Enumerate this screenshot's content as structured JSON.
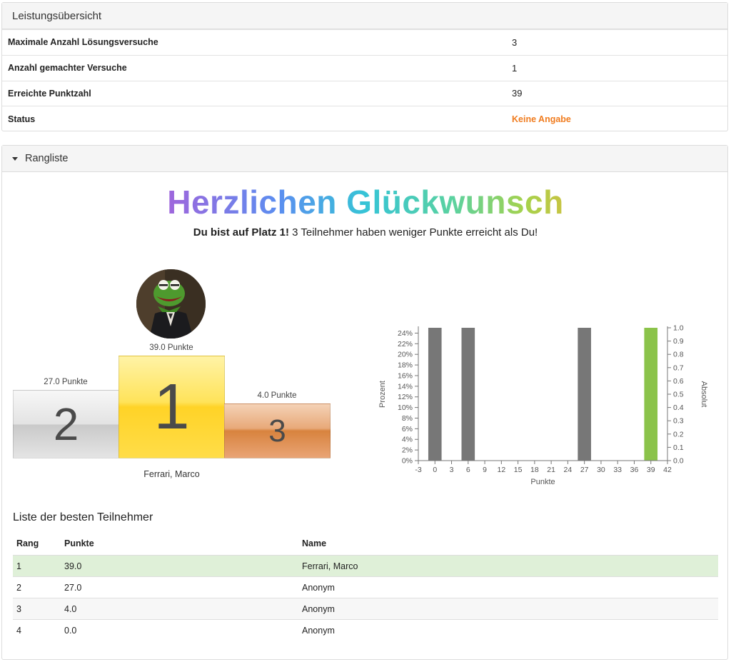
{
  "overview": {
    "title": "Leistungsübersicht",
    "rows": [
      {
        "label": "Maximale Anzahl Lösungsversuche",
        "value": "3"
      },
      {
        "label": "Anzahl gemachter Versuche",
        "value": "1"
      },
      {
        "label": "Erreichte Punktzahl",
        "value": "39"
      },
      {
        "label": "Status",
        "value": "Keine Angabe"
      }
    ]
  },
  "ranking": {
    "title": "Rangliste",
    "congrats": "Herzlichen Glückwunsch",
    "subline_bold": "Du bist auf Platz 1!",
    "subline_rest": " 3 Teilnehmer haben weniger Punkte erreicht als Du!",
    "podium": {
      "first": {
        "rank": "1",
        "points": "39.0 Punkte",
        "name": "Ferrari, Marco"
      },
      "second": {
        "rank": "2",
        "points": "27.0 Punkte"
      },
      "third": {
        "rank": "3",
        "points": "4.0 Punkte"
      }
    },
    "list_title": "Liste der besten Teilnehmer",
    "columns": [
      "Rang",
      "Punkte",
      "Name"
    ],
    "rows": [
      {
        "rank": "1",
        "points": "39.0",
        "name": "Ferrari, Marco"
      },
      {
        "rank": "2",
        "points": "27.0",
        "name": "Anonym"
      },
      {
        "rank": "3",
        "points": "4.0",
        "name": "Anonym"
      },
      {
        "rank": "4",
        "points": "0.0",
        "name": "Anonym"
      }
    ]
  },
  "colors": {
    "status_orange": "#f07c1f",
    "bar_gray": "#777777",
    "bar_green": "#8bc34a",
    "highlight_row": "#dff0d8"
  },
  "chart_data": {
    "type": "bar",
    "xlabel": "Punkte",
    "ylabel": "Prozent",
    "y2label": "Absolut",
    "x_ticks": [
      -3,
      0,
      3,
      6,
      9,
      12,
      15,
      18,
      21,
      24,
      27,
      30,
      33,
      36,
      39,
      42
    ],
    "xlim": [
      -3,
      42
    ],
    "y_ticks": [
      "0%",
      "2%",
      "4%",
      "6%",
      "8%",
      "10%",
      "12%",
      "14%",
      "16%",
      "18%",
      "20%",
      "22%",
      "24%"
    ],
    "ylim": [
      0,
      25
    ],
    "y2_ticks": [
      "0.0",
      "0.1",
      "0.2",
      "0.3",
      "0.4",
      "0.5",
      "0.6",
      "0.7",
      "0.8",
      "0.9",
      "1.0"
    ],
    "y2lim": [
      0,
      1
    ],
    "bars": [
      {
        "x": 0,
        "percent": 25,
        "absolute": 1,
        "highlight": false
      },
      {
        "x": 6,
        "percent": 25,
        "absolute": 1,
        "highlight": false
      },
      {
        "x": 27,
        "percent": 25,
        "absolute": 1,
        "highlight": false
      },
      {
        "x": 39,
        "percent": 25,
        "absolute": 1,
        "highlight": true
      }
    ]
  }
}
